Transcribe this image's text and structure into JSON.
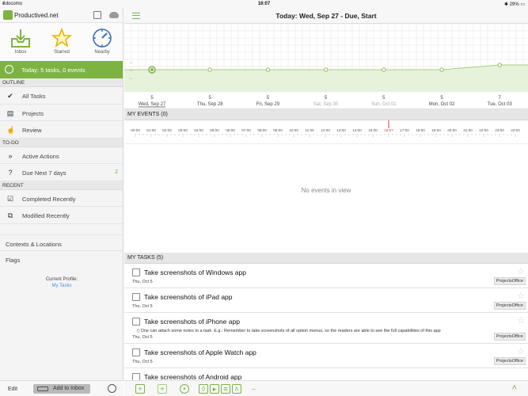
{
  "status": {
    "carrier": "docomo",
    "time": "16:07",
    "battery": "29%"
  },
  "sidebar": {
    "account": "Productived.net",
    "quick": [
      {
        "label": "Inbox",
        "icon": "inbox-icon"
      },
      {
        "label": "Starred",
        "icon": "star-icon"
      },
      {
        "label": "Nearby",
        "icon": "compass-icon"
      }
    ],
    "today_label": "Today: 5 tasks, 0 events",
    "outline_header": "OUTLINE",
    "outline": [
      {
        "label": "All Tasks",
        "icon": "check-list-icon",
        "glyph": "✔"
      },
      {
        "label": "Projects",
        "icon": "projects-icon",
        "glyph": "▤"
      },
      {
        "label": "Review",
        "icon": "review-hand-icon",
        "glyph": "☝"
      }
    ],
    "todo_header": "TO-DO",
    "todo": [
      {
        "label": "Active Actions",
        "icon": "active-actions-icon",
        "glyph": "»",
        "count": ""
      },
      {
        "label": "Due Next 7 days",
        "icon": "due-icon",
        "glyph": "?",
        "count": "2"
      }
    ],
    "recent_header": "RECENT",
    "recent": [
      {
        "label": "Completed Recently",
        "icon": "completed-icon",
        "glyph": "☑"
      },
      {
        "label": "Modified Recently",
        "icon": "modified-icon",
        "glyph": "⧉"
      }
    ],
    "contexts": "Contexts & Locations",
    "flags": "Flags",
    "profile_label": "Current Profile:",
    "profile_name": "My Tasks",
    "edit": "Edit",
    "add_inbox": "Add to Inbox"
  },
  "main": {
    "title": "Today: Wed, Sep 27 - Due, Start",
    "events_header": "MY EVENTS (0)",
    "no_events": "No events in view",
    "tasks_header": "MY TASKS (5)",
    "hours": [
      "00:00",
      "01:00",
      "02:00",
      "03:00",
      "04:00",
      "05:00",
      "06:00",
      "07:00",
      "08:00",
      "09:00",
      "10:00",
      "11:00",
      "12:00",
      "13:00",
      "14:00",
      "15:00",
      "16:07",
      "17:00",
      "18:00",
      "19:00",
      "20:00",
      "21:00",
      "22:00",
      "23:00",
      "24:00"
    ],
    "tasks": [
      {
        "name": "Take screenshots of Windows app",
        "date": "Thu, Oct 5",
        "tag": "ProjectsOffice",
        "note": ""
      },
      {
        "name": "Take screenshots of iPad app",
        "date": "Thu, Oct 5",
        "tag": "ProjectsOffice",
        "note": ""
      },
      {
        "name": "Take screenshots of iPhone app",
        "date": "Thu, Oct 5",
        "tag": "ProjectsOffice",
        "note": "One can attach some notes to a task. E.g.: Remember to take screenshots of all option menus, so the readers are able to see the full capabilities of this app"
      },
      {
        "name": "Take screenshots of Apple Watch app",
        "date": "Thu, Oct 5",
        "tag": "ProjectsOffice",
        "note": ""
      },
      {
        "name": "Take screenshots of Android app",
        "date": "",
        "tag": "",
        "note": ""
      }
    ]
  },
  "colors": {
    "accent": "#7cb342",
    "link": "#4a90d9",
    "now": "#e53935"
  },
  "chart_data": {
    "type": "area",
    "categories": [
      "Wed, Sep 27",
      "Thu, Sep 28",
      "Fri, Sep 29",
      "Sat, Sep 30",
      "Sun, Oct 01",
      "Mon, Oct 02",
      "Tue, Oct 03"
    ],
    "values": [
      5,
      5,
      5,
      5,
      5,
      5,
      7
    ],
    "value_labels": [
      "5",
      "5",
      "5",
      "5",
      "5",
      "5",
      "7"
    ],
    "title": "",
    "xlabel": "",
    "ylabel": "",
    "grid": true
  }
}
